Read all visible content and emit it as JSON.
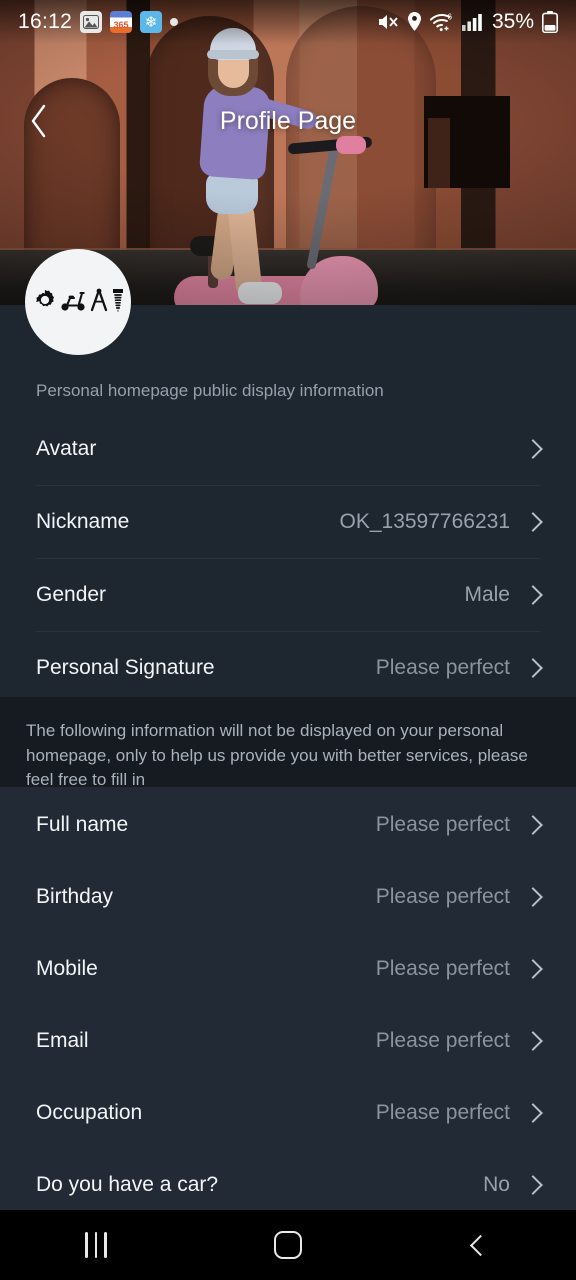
{
  "status_bar": {
    "time": "16:12",
    "notification_icons": [
      "photo-icon",
      "calendar-365-icon",
      "snowflake-app-icon",
      "dot-icon"
    ],
    "badge_365": "365",
    "snowflake": "❄",
    "right_icons": [
      "mute-icon",
      "location-pin-icon",
      "wifi-6-icon",
      "cellular-signal-icon"
    ],
    "battery_percent": "35%",
    "wifi_generation": "6"
  },
  "header": {
    "title": "Profile Page",
    "back_icon": "chevron-left-icon",
    "banner_description": "Woman in purple jacket riding a pink electric scooter in front of a salmon stucco wall"
  },
  "avatar": {
    "name": "profile-avatar",
    "glyphs": [
      "gear-icon",
      "scooter-icon",
      "compass-divider-icon",
      "screw-icon"
    ],
    "background_color": "#f3f4f6",
    "glyph_color": "#111111"
  },
  "public_section": {
    "caption": "Personal homepage public display information",
    "rows": [
      {
        "label": "Avatar",
        "value": "",
        "chevron": "chevron-right-icon",
        "name": "row-avatar"
      },
      {
        "label": "Nickname",
        "value": "OK_13597766231",
        "chevron": "chevron-right-icon",
        "name": "row-nickname"
      },
      {
        "label": "Gender",
        "value": "Male",
        "chevron": "chevron-right-icon",
        "name": "row-gender"
      },
      {
        "label": "Personal Signature",
        "value": "Please perfect",
        "chevron": "chevron-right-icon",
        "name": "row-personal-signature"
      }
    ]
  },
  "notice": {
    "text": "The following information will not be displayed on your personal homepage, only to help us provide you with better services, please feel free to fill in"
  },
  "private_section": {
    "rows": [
      {
        "label": "Full name",
        "value": "Please perfect",
        "chevron": "chevron-right-icon",
        "name": "row-full-name"
      },
      {
        "label": "Birthday",
        "value": "Please perfect",
        "chevron": "chevron-right-icon",
        "name": "row-birthday"
      },
      {
        "label": "Mobile",
        "value": "Please perfect",
        "chevron": "chevron-right-icon",
        "name": "row-mobile"
      },
      {
        "label": "Email",
        "value": "Please perfect",
        "chevron": "chevron-right-icon",
        "name": "row-email"
      },
      {
        "label": "Occupation",
        "value": "Please perfect",
        "chevron": "chevron-right-icon",
        "name": "row-occupation"
      },
      {
        "label": "Do you have a car?",
        "value": "No",
        "chevron": "chevron-right-icon",
        "name": "row-have-car"
      }
    ]
  },
  "nav_bar": {
    "recents_label": "recents-icon",
    "home_label": "home-icon",
    "back_label": "back-icon"
  },
  "colors": {
    "page_background": "#1e2630",
    "section_background": "#222a35",
    "notice_background": "#161b21",
    "primary_text": "#f2f5f8",
    "secondary_text": "#98a1ac",
    "caption_text": "#96a0ab",
    "divider": "#2a323d",
    "navbar": "#000000"
  }
}
